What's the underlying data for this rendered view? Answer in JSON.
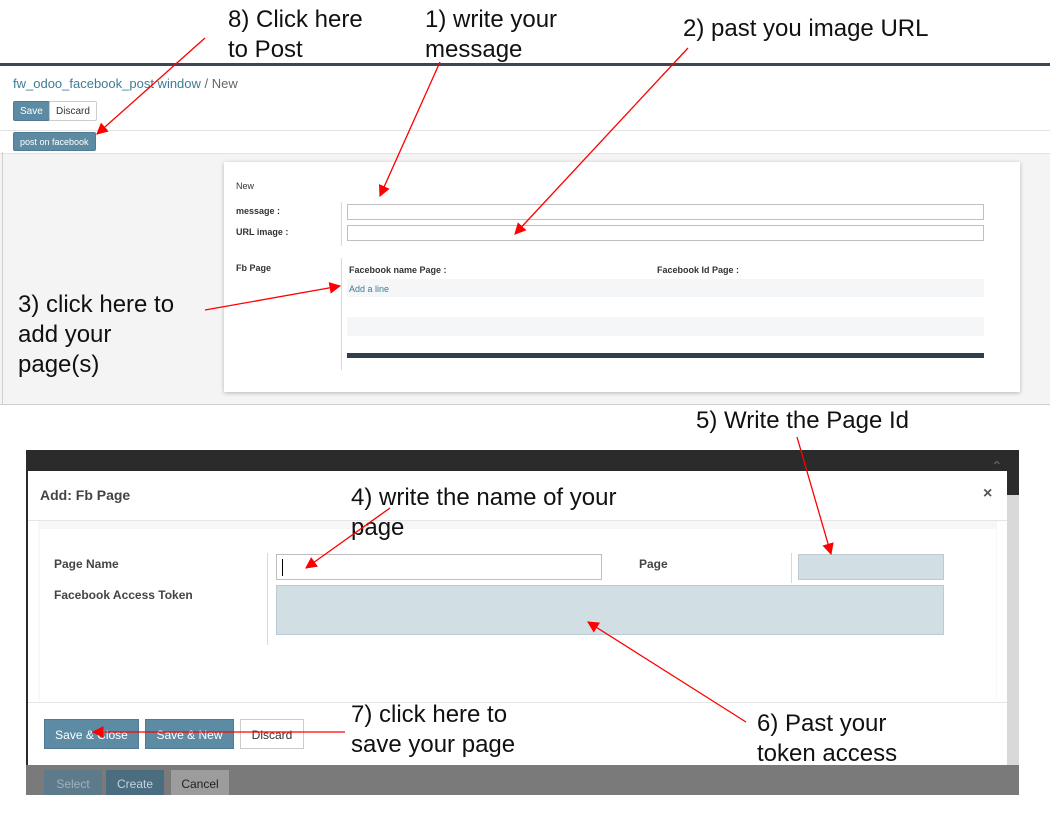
{
  "annotations": {
    "step8": "8) Click here\nto Post",
    "step1": "1) write your\nmessage",
    "step2": "2) past you image URL",
    "step3": "3) click here to\nadd your\npage(s)",
    "step5": "5) Write the Page Id",
    "step4": "4) write the name of your\npage",
    "step7": "7) click here to\nsave your page",
    "step6": "6) Past your\ntoken access",
    "arrow_color": "#ff0000"
  },
  "form_view": {
    "breadcrumb": {
      "parent": "fw_odoo_facebook_post window",
      "separator": "/",
      "current": "New"
    },
    "buttons": {
      "save": "Save",
      "discard": "Discard"
    },
    "header_button": "post on facebook",
    "sheet": {
      "status": "New",
      "message_label": "message :",
      "message_value": "",
      "url_label": "URL image :",
      "url_value": "",
      "fb_page_label": "Fb Page",
      "columns": [
        "Facebook name Page :",
        "Facebook Id Page :"
      ],
      "add_line": "Add a line"
    }
  },
  "dialog": {
    "title": "Add: Fb Page",
    "close_symbol": "×",
    "page_name_label": "Page Name",
    "page_name_value": "",
    "page_label": "Page",
    "page_value": "",
    "token_label": "Facebook Access Token",
    "token_value": "",
    "buttons": {
      "save_close": "Save & Close",
      "save_new": "Save & New",
      "discard": "Discard"
    },
    "background_buttons": {
      "select": "Select",
      "create": "Create",
      "cancel": "Cancel"
    }
  },
  "colors": {
    "primary_button": "#5d8ba3",
    "link": "#3e7c95",
    "required_field": "#d1dfe5",
    "dark_rule": "#2f3e4a"
  }
}
